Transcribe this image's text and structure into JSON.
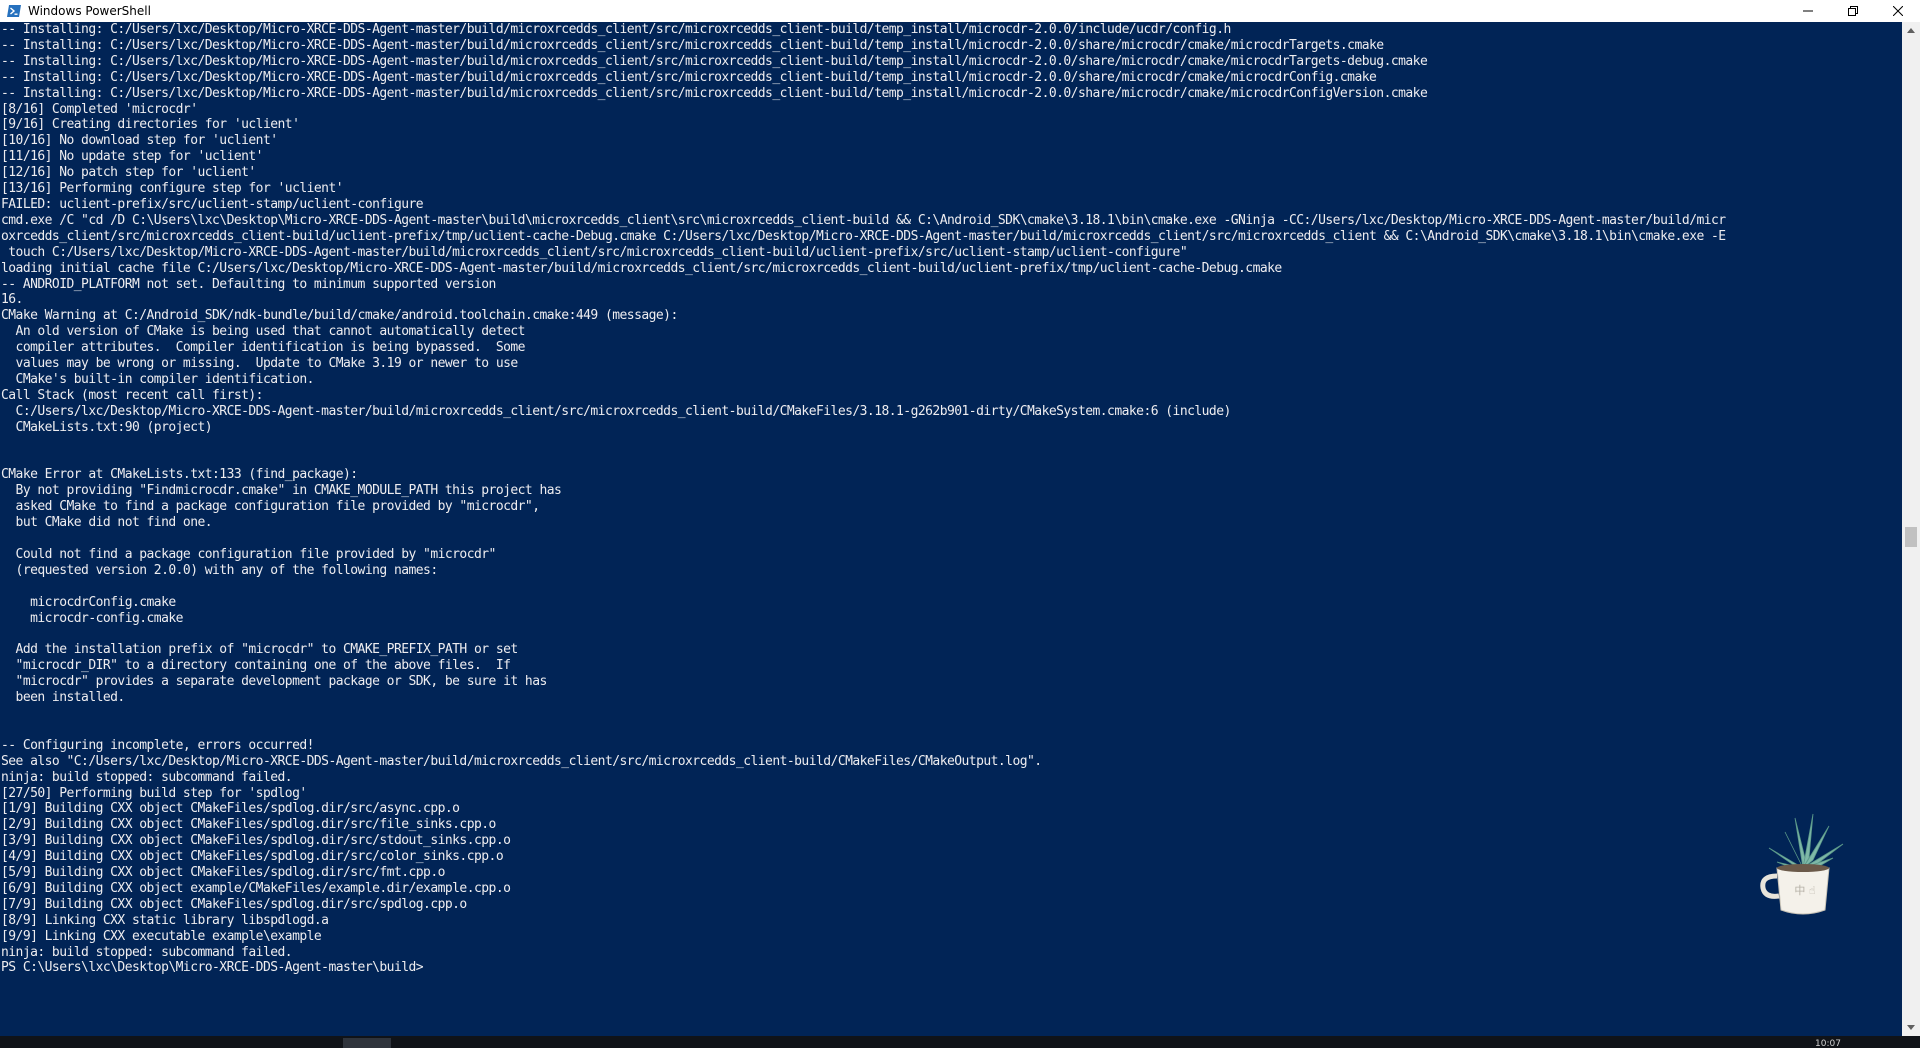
{
  "window": {
    "title": "Windows PowerShell",
    "icon": "powershell-icon",
    "controls": [
      "minimize-icon",
      "restore-icon",
      "close-icon"
    ]
  },
  "colors": {
    "console_background": "#012456",
    "console_text": "#eeedf0",
    "titlebar_background": "#ffffff"
  },
  "console": {
    "lines": [
      "-- Installing: C:/Users/lxc/Desktop/Micro-XRCE-DDS-Agent-master/build/microxrcedds_client/src/microxrcedds_client-build/temp_install/microcdr-2.0.0/include/ucdr/config.h",
      "-- Installing: C:/Users/lxc/Desktop/Micro-XRCE-DDS-Agent-master/build/microxrcedds_client/src/microxrcedds_client-build/temp_install/microcdr-2.0.0/share/microcdr/cmake/microcdrTargets.cmake",
      "-- Installing: C:/Users/lxc/Desktop/Micro-XRCE-DDS-Agent-master/build/microxrcedds_client/src/microxrcedds_client-build/temp_install/microcdr-2.0.0/share/microcdr/cmake/microcdrTargets-debug.cmake",
      "-- Installing: C:/Users/lxc/Desktop/Micro-XRCE-DDS-Agent-master/build/microxrcedds_client/src/microxrcedds_client-build/temp_install/microcdr-2.0.0/share/microcdr/cmake/microcdrConfig.cmake",
      "-- Installing: C:/Users/lxc/Desktop/Micro-XRCE-DDS-Agent-master/build/microxrcedds_client/src/microxrcedds_client-build/temp_install/microcdr-2.0.0/share/microcdr/cmake/microcdrConfigVersion.cmake",
      "[8/16] Completed 'microcdr'",
      "[9/16] Creating directories for 'uclient'",
      "[10/16] No download step for 'uclient'",
      "[11/16] No update step for 'uclient'",
      "[12/16] No patch step for 'uclient'",
      "[13/16] Performing configure step for 'uclient'",
      "FAILED: uclient-prefix/src/uclient-stamp/uclient-configure",
      "cmd.exe /C \"cd /D C:\\Users\\lxc\\Desktop\\Micro-XRCE-DDS-Agent-master\\build\\microxrcedds_client\\src\\microxrcedds_client-build && C:\\Android_SDK\\cmake\\3.18.1\\bin\\cmake.exe -GNinja -CC:/Users/lxc/Desktop/Micro-XRCE-DDS-Agent-master/build/micr",
      "oxrcedds_client/src/microxrcedds_client-build/uclient-prefix/tmp/uclient-cache-Debug.cmake C:/Users/lxc/Desktop/Micro-XRCE-DDS-Agent-master/build/microxrcedds_client/src/microxrcedds_client && C:\\Android_SDK\\cmake\\3.18.1\\bin\\cmake.exe -E",
      " touch C:/Users/lxc/Desktop/Micro-XRCE-DDS-Agent-master/build/microxrcedds_client/src/microxrcedds_client-build/uclient-prefix/src/uclient-stamp/uclient-configure\"",
      "loading initial cache file C:/Users/lxc/Desktop/Micro-XRCE-DDS-Agent-master/build/microxrcedds_client/src/microxrcedds_client-build/uclient-prefix/tmp/uclient-cache-Debug.cmake",
      "-- ANDROID_PLATFORM not set. Defaulting to minimum supported version",
      "16.",
      "CMake Warning at C:/Android_SDK/ndk-bundle/build/cmake/android.toolchain.cmake:449 (message):",
      "  An old version of CMake is being used that cannot automatically detect",
      "  compiler attributes.  Compiler identification is being bypassed.  Some",
      "  values may be wrong or missing.  Update to CMake 3.19 or newer to use",
      "  CMake's built-in compiler identification.",
      "Call Stack (most recent call first):",
      "  C:/Users/lxc/Desktop/Micro-XRCE-DDS-Agent-master/build/microxrcedds_client/src/microxrcedds_client-build/CMakeFiles/3.18.1-g262b901-dirty/CMakeSystem.cmake:6 (include)",
      "  CMakeLists.txt:90 (project)",
      "",
      "",
      "CMake Error at CMakeLists.txt:133 (find_package):",
      "  By not providing \"Findmicrocdr.cmake\" in CMAKE_MODULE_PATH this project has",
      "  asked CMake to find a package configuration file provided by \"microcdr\",",
      "  but CMake did not find one.",
      "",
      "  Could not find a package configuration file provided by \"microcdr\"",
      "  (requested version 2.0.0) with any of the following names:",
      "",
      "    microcdrConfig.cmake",
      "    microcdr-config.cmake",
      "",
      "  Add the installation prefix of \"microcdr\" to CMAKE_PREFIX_PATH or set",
      "  \"microcdr_DIR\" to a directory containing one of the above files.  If",
      "  \"microcdr\" provides a separate development package or SDK, be sure it has",
      "  been installed.",
      "",
      "",
      "-- Configuring incomplete, errors occurred!",
      "See also \"C:/Users/lxc/Desktop/Micro-XRCE-DDS-Agent-master/build/microxrcedds_client/src/microxrcedds_client-build/CMakeFiles/CMakeOutput.log\".",
      "ninja: build stopped: subcommand failed.",
      "[27/50] Performing build step for 'spdlog'",
      "[1/9] Building CXX object CMakeFiles/spdlog.dir/src/async.cpp.o",
      "[2/9] Building CXX object CMakeFiles/spdlog.dir/src/file_sinks.cpp.o",
      "[3/9] Building CXX object CMakeFiles/spdlog.dir/src/stdout_sinks.cpp.o",
      "[4/9] Building CXX object CMakeFiles/spdlog.dir/src/color_sinks.cpp.o",
      "[5/9] Building CXX object CMakeFiles/spdlog.dir/src/fmt.cpp.o",
      "[6/9] Building CXX object example/CMakeFiles/example.dir/example.cpp.o",
      "[7/9] Building CXX object CMakeFiles/spdlog.dir/src/spdlog.cpp.o",
      "[8/9] Linking CXX static library libspdlogd.a",
      "[9/9] Linking CXX executable example\\example",
      "ninja: build stopped: subcommand failed.",
      "PS C:\\Users\\lxc\\Desktop\\Micro-XRCE-DDS-Agent-master\\build>"
    ]
  },
  "widget": {
    "icon": "potted-plant-cup-icon",
    "label": "中 ☝"
  },
  "taskbar": {
    "clock_fragment": "10:07"
  }
}
